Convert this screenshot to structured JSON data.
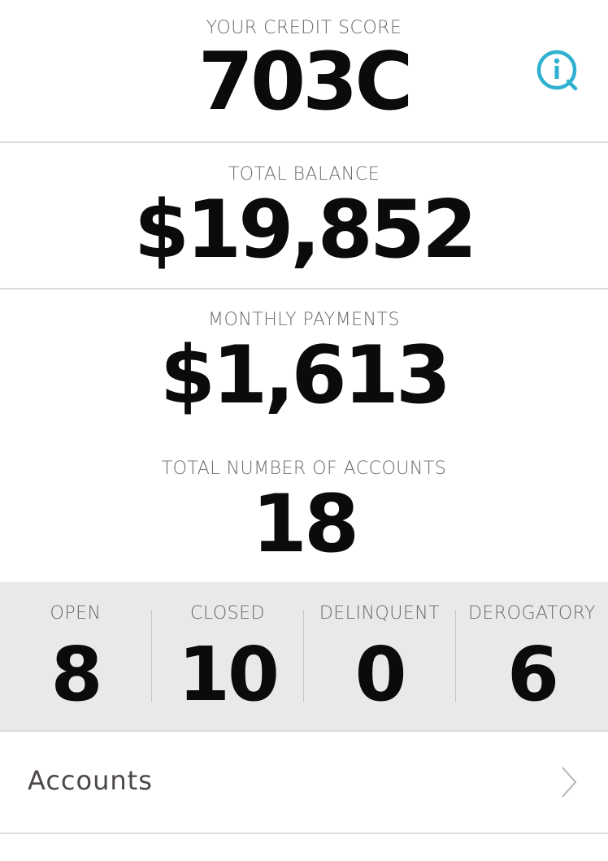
{
  "credit_score": {
    "label": "YOUR CREDIT SCORE",
    "value": "703C"
  },
  "total_balance": {
    "label": "TOTAL BALANCE",
    "value": "$19,852"
  },
  "monthly_payments": {
    "label": "MONTHLY PAYMENTS",
    "value": "$1,613"
  },
  "total_accounts": {
    "label": "TOTAL NUMBER OF ACCOUNTS",
    "value": "18"
  },
  "stats": [
    {
      "label": "OPEN",
      "value": "8"
    },
    {
      "label": "CLOSED",
      "value": "10"
    },
    {
      "label": "DELINQUENT",
      "value": "0"
    },
    {
      "label": "DEROGATORY",
      "value": "6"
    }
  ],
  "accounts_row": {
    "label": "Accounts"
  },
  "icons": {
    "info": "info-icon",
    "chevron": "chevron-right-icon"
  },
  "colors": {
    "accent": "#2fb1cf",
    "stats_background": "#e8e9eb",
    "divider": "#dcdcdc",
    "label_text": "#6a6a6a",
    "value_text": "#0b0b0b"
  }
}
